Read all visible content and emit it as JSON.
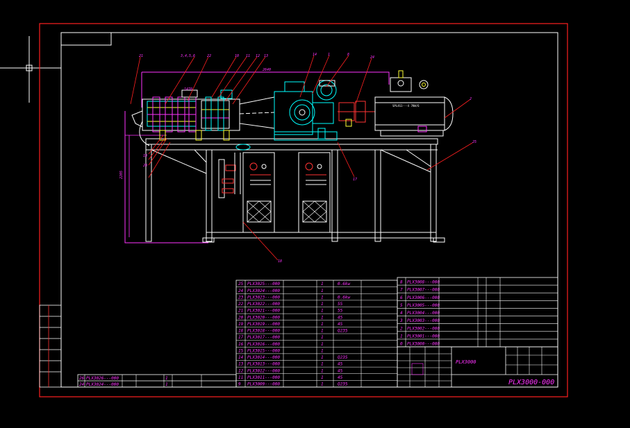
{
  "drawing": {
    "number": "PLX3000-000",
    "title_block_number": "PLX3000",
    "title_name": "",
    "small_text_1": "2640",
    "small_text_2": "1470",
    "small_text_3": "2205",
    "motor_label": "SPL4S1---4  7KW/6"
  },
  "colors": {
    "background": "#000000",
    "frame": "#ff0000",
    "outline": "#ffffff",
    "machine": "#ff33ff",
    "parts": "#00ffff",
    "accent": "#ffff00",
    "dimension": "#ff00ff"
  },
  "balloons": [
    {
      "label": "21"
    },
    {
      "label": "3,4,5,6"
    },
    {
      "label": "22"
    },
    {
      "label": "10"
    },
    {
      "label": "11"
    },
    {
      "label": "12"
    },
    {
      "label": "13"
    },
    {
      "label": "14"
    },
    {
      "label": "1"
    },
    {
      "label": "8"
    },
    {
      "label": "24"
    },
    {
      "label": "2"
    },
    {
      "label": "25"
    },
    {
      "label": "17"
    },
    {
      "label": "19"
    },
    {
      "label": "20"
    },
    {
      "label": "18"
    }
  ],
  "bom_left": [
    {
      "no": "25",
      "code": "PLX3025---000",
      "name": "",
      "qty": "1",
      "mat": "",
      "note": "",
      "material": "0.6kw"
    },
    {
      "no": "24",
      "code": "PLX3024---000",
      "name": "",
      "qty": "1",
      "mat": "",
      "note": "",
      "material": ""
    },
    {
      "no": "23",
      "code": "PLX3023---000",
      "name": "",
      "qty": "1",
      "mat": "",
      "note": "",
      "material": "0.6kw"
    },
    {
      "no": "22",
      "code": "PLX3022---000",
      "name": "",
      "qty": "1",
      "mat": "",
      "note": "",
      "material": "55"
    },
    {
      "no": "21",
      "code": "PLX3021---000",
      "name": "",
      "qty": "1",
      "mat": "",
      "note": "",
      "material": "55"
    },
    {
      "no": "20",
      "code": "PLX3020---000",
      "name": "",
      "qty": "1",
      "mat": "",
      "note": "",
      "material": "45"
    },
    {
      "no": "19",
      "code": "PLX3019---000",
      "name": "",
      "qty": "1",
      "mat": "",
      "note": "",
      "material": "45"
    },
    {
      "no": "18",
      "code": "PLX3018---000",
      "name": "",
      "qty": "1",
      "mat": "",
      "note": "",
      "material": "Q235"
    },
    {
      "no": "17",
      "code": "PLX3017---000",
      "name": "",
      "qty": "1",
      "mat": "",
      "note": "",
      "material": ""
    },
    {
      "no": "16",
      "code": "PLX3016---000",
      "name": "",
      "qty": "1",
      "mat": "",
      "note": "",
      "material": ""
    },
    {
      "no": "15",
      "code": "PLX3015---000",
      "name": "",
      "qty": "1",
      "mat": "",
      "note": "",
      "material": ""
    },
    {
      "no": "14",
      "code": "PLX3014---000",
      "name": "",
      "qty": "1",
      "mat": "",
      "note": "",
      "material": "Q235"
    },
    {
      "no": "13",
      "code": "PLX3013---000",
      "name": "",
      "qty": "1",
      "mat": "",
      "note": "",
      "material": "45"
    },
    {
      "no": "12",
      "code": "PLX3012---000",
      "name": "",
      "qty": "1",
      "mat": "",
      "note": "",
      "material": "45"
    },
    {
      "no": "11",
      "code": "PLX3011---000",
      "name": "",
      "qty": "1",
      "mat": "",
      "note": "",
      "material": "45"
    },
    {
      "no": "9",
      "code": "PLX3009---000",
      "name": "",
      "qty": "1",
      "mat": "",
      "note": "",
      "material": "Q235"
    }
  ],
  "bom_bottom_left": [
    {
      "no": "26",
      "code": "PLX3026---000",
      "name": "",
      "qty": "1",
      "spec": "",
      "extra": ""
    },
    {
      "no": "24",
      "code": "PLX3024---000",
      "name": "",
      "qty": "1",
      "spec": "",
      "extra": ""
    }
  ],
  "bom_right": [
    {
      "no": "8",
      "code": "PLX3008---000"
    },
    {
      "no": "7",
      "code": "PLX3007---000"
    },
    {
      "no": "6",
      "code": "PLX3006---000"
    },
    {
      "no": "5",
      "code": "PLX3005---000"
    },
    {
      "no": "4",
      "code": "PLX3004---000"
    },
    {
      "no": "3",
      "code": "PLX3003---000"
    },
    {
      "no": "2",
      "code": "PLX3002---000"
    },
    {
      "no": "1",
      "code": "PLX3001---000"
    },
    {
      "no": "0",
      "code": "PLX3000---000"
    }
  ]
}
